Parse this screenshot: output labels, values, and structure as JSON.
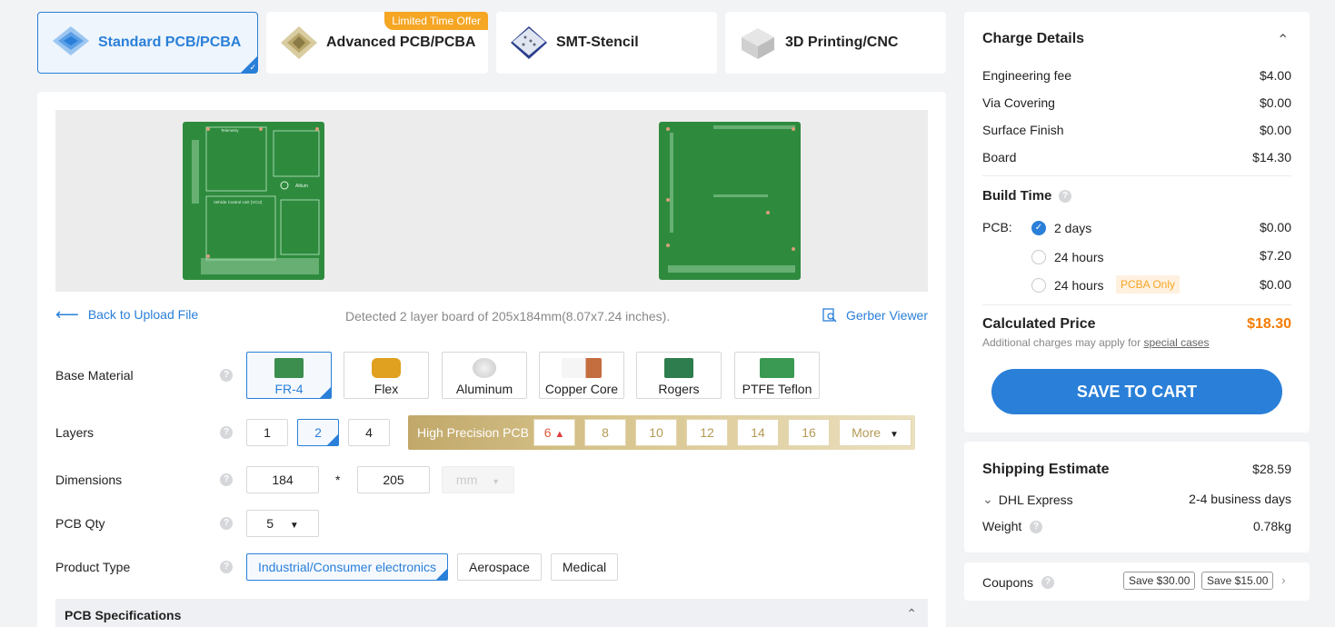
{
  "tabs": [
    {
      "label": "Standard PCB/PCBA",
      "icon": "standard-pcb-icon",
      "active": true
    },
    {
      "label": "Advanced PCB/PCBA",
      "icon": "advanced-pcb-icon",
      "badge": "Limited Time Offer"
    },
    {
      "label": "SMT-Stencil",
      "icon": "smt-stencil-icon"
    },
    {
      "label": "3D Printing/CNC",
      "icon": "3d-printing-icon"
    }
  ],
  "preview": {
    "back_link": "Back to Upload File",
    "detected": "Detected 2 layer board of 205x184mm(8.07x7.24 inches).",
    "gerber_viewer": "Gerber Viewer",
    "board_texts": {
      "telemetry": "Telemetry",
      "vcu": "Vehicle Control Unit (VCU)",
      "brand": "Altium"
    }
  },
  "form": {
    "base_material": {
      "label": "Base Material",
      "options": [
        "FR-4",
        "Flex",
        "Aluminum",
        "Copper Core",
        "Rogers",
        "PTFE Teflon"
      ],
      "selected": "FR-4"
    },
    "layers": {
      "label": "Layers",
      "options": [
        "1",
        "2",
        "4"
      ],
      "selected": "2",
      "high_precision_label": "High Precision PCB",
      "high_precision_options": [
        "6",
        "8",
        "10",
        "12",
        "14",
        "16"
      ],
      "more": "More"
    },
    "dimensions": {
      "label": "Dimensions",
      "width": "184",
      "sep": "*",
      "height": "205",
      "unit": "mm"
    },
    "pcb_qty": {
      "label": "PCB Qty",
      "value": "5"
    },
    "product_type": {
      "label": "Product Type",
      "options": [
        "Industrial/Consumer electronics",
        "Aerospace",
        "Medical"
      ],
      "selected": "Industrial/Consumer electronics"
    },
    "specs_header": "PCB Specifications"
  },
  "charge": {
    "title": "Charge Details",
    "items": [
      {
        "label": "Engineering fee",
        "value": "$4.00"
      },
      {
        "label": "Via Covering",
        "value": "$0.00"
      },
      {
        "label": "Surface Finish",
        "value": "$0.00"
      },
      {
        "label": "Board",
        "value": "$14.30"
      }
    ],
    "build_time": {
      "title": "Build Time",
      "pcb_label": "PCB:",
      "options": [
        {
          "label": "2 days",
          "value": "$0.00",
          "selected": true
        },
        {
          "label": "24 hours",
          "value": "$7.20"
        },
        {
          "label": "24 hours",
          "value": "$0.00",
          "tag": "PCBA Only"
        }
      ]
    },
    "calculated_label": "Calculated Price",
    "calculated_value": "$18.30",
    "note_prefix": "Additional charges may apply for",
    "note_link": "special cases",
    "save_button": "SAVE TO CART"
  },
  "shipping": {
    "title": "Shipping Estimate",
    "value": "$28.59",
    "carrier": "DHL Express",
    "days": "2-4 business days",
    "weight_label": "Weight",
    "weight_value": "0.78kg"
  },
  "coupons": {
    "label": "Coupons",
    "items": [
      "Save $30.00",
      "Save $15.00"
    ]
  },
  "colors": {
    "accent": "#2a7fd8",
    "price": "#f57c00",
    "offer": "#f5a623",
    "pcb_green": "#2e8b3e"
  }
}
